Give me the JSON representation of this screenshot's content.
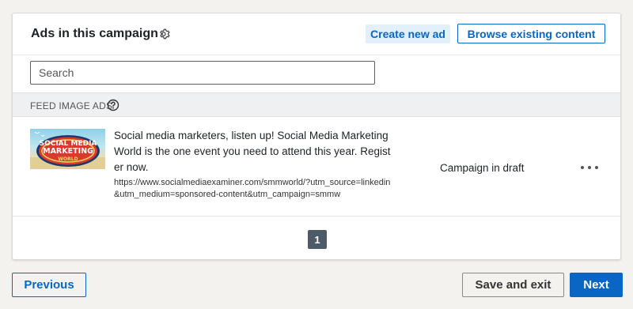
{
  "header": {
    "title": "Ads in this campaign",
    "settings_icon": "gear-icon",
    "create_label": "Create new ad",
    "browse_label": "Browse existing content"
  },
  "search": {
    "placeholder": "Search",
    "value": ""
  },
  "section": {
    "label": "FEED IMAGE ADS",
    "help_icon": "question-circle-icon"
  },
  "ads": [
    {
      "thumbnail_text": [
        "SOCIAL MEDIA",
        "MARKETING",
        "WORLD"
      ],
      "text": "Social media marketers, listen up! Social Media Marketing World is the one event you need to attend this year. Register now.",
      "url": "https://www.socialmediaexaminer.com/smmworld/?utm_source=linkedin&utm_medium=sponsored-content&utm_campaign=smmw",
      "status": "Campaign in draft",
      "menu_icon": "more-horizontal-icon"
    }
  ],
  "pagination": {
    "current": "1"
  },
  "footer": {
    "previous_label": "Previous",
    "save_exit_label": "Save and exit",
    "next_label": "Next"
  },
  "colors": {
    "accent": "#0a66c2",
    "accent_light": "#e1f0fa",
    "background": "#f3f2ef",
    "pager": "#4d5b68"
  }
}
